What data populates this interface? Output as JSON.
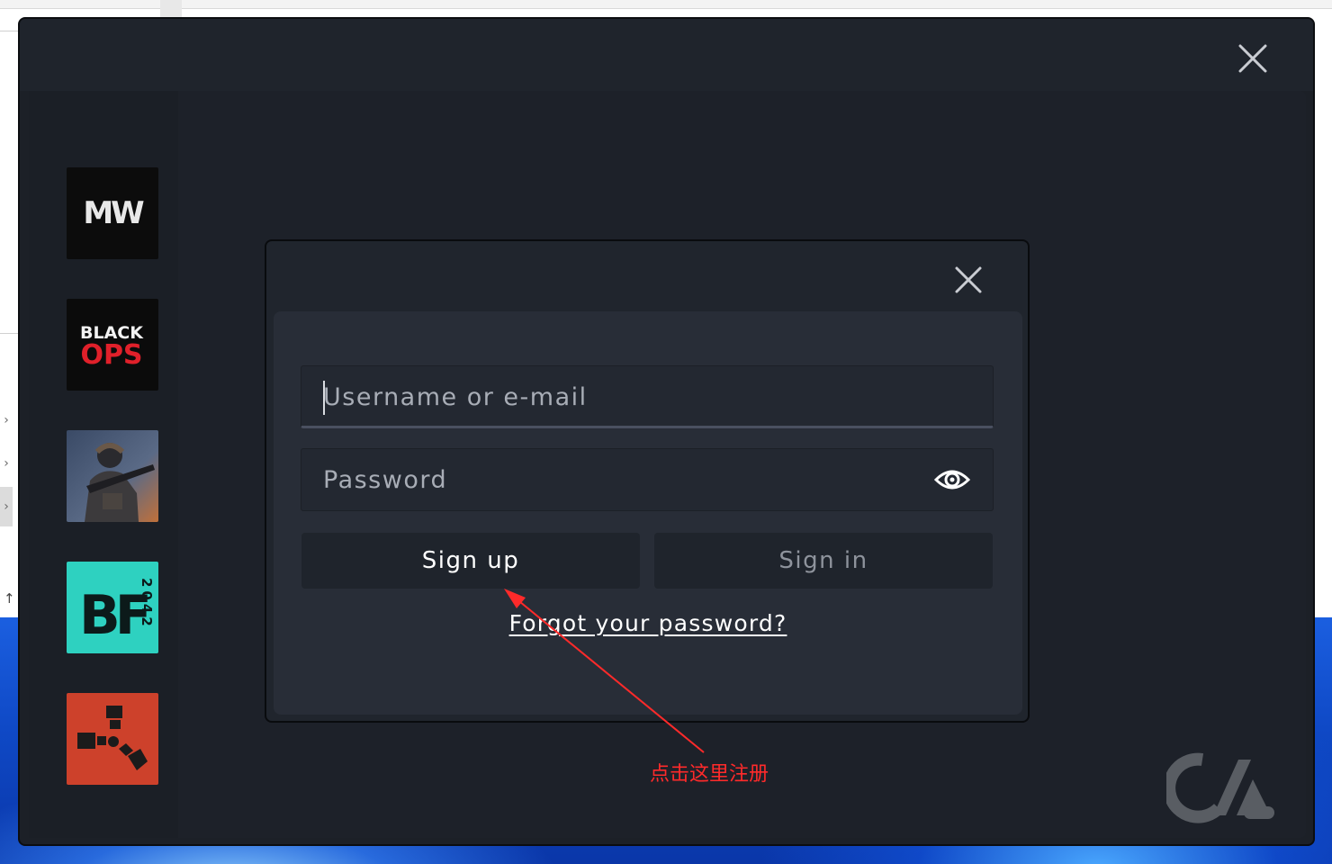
{
  "login": {
    "username_placeholder": "Username or e-mail",
    "password_placeholder": "Password",
    "signup_label": "Sign up",
    "signin_label": "Sign in",
    "forgot_label": "Forgot your password?"
  },
  "games": [
    {
      "icon": "modern-warfare-logo",
      "text": "MW"
    },
    {
      "icon": "black-ops-logo",
      "text_line1": "BLACK",
      "text_line2": "OPS"
    },
    {
      "icon": "soldier-game-art"
    },
    {
      "icon": "battlefield-2042-logo",
      "text": "BF",
      "subtext": "2042"
    },
    {
      "icon": "rust-logo"
    }
  ],
  "annotation": {
    "text": "点击这里注册",
    "color": "#ff2a2a"
  },
  "colors": {
    "launcher_bg": "#1c2027",
    "dialog_bg": "#20252d",
    "panel_bg": "#282d37",
    "field_bg": "#232831",
    "button_bg": "#1f242c",
    "bf_accent": "#2ed1c0",
    "rust_accent": "#cd412b",
    "black_ops_red": "#e0202a"
  }
}
